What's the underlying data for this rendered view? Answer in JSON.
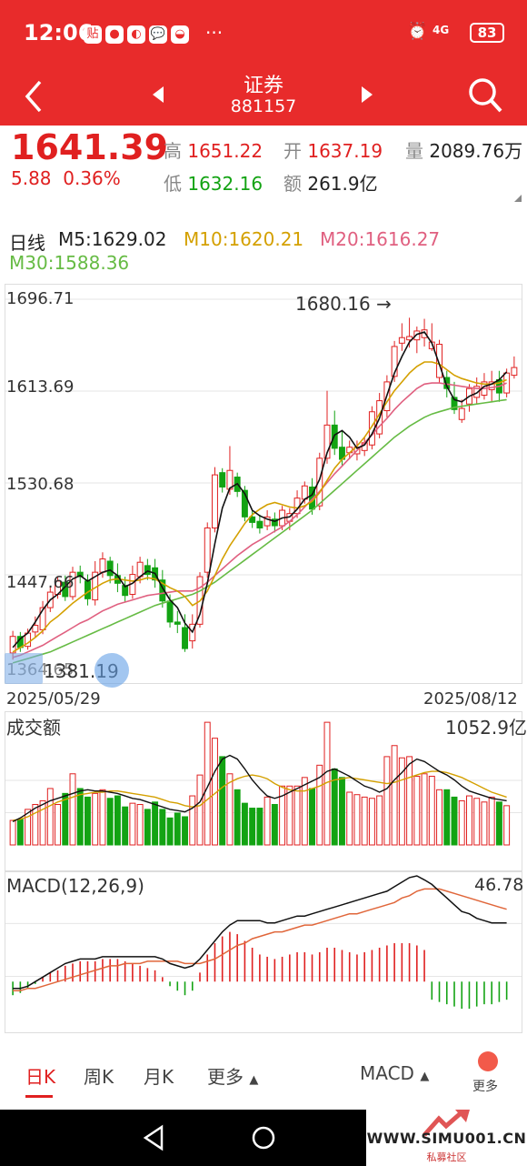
{
  "status": {
    "time": "12:06",
    "apps": [
      "贴",
      "●",
      "◐",
      "💬",
      "◒"
    ],
    "more": "···",
    "alarm": "⏰",
    "net": "4G",
    "battery": "83"
  },
  "nav": {
    "back_icon": "chevron-left-icon",
    "prev_icon": "triangle-left-icon",
    "next_icon": "triangle-right-icon",
    "title": "证券",
    "code": "881157",
    "search_icon": "search-icon"
  },
  "quote": {
    "price": "1641.39",
    "change": "5.88",
    "change_pct": "0.36%",
    "high_label": "高",
    "high": "1651.22",
    "open_label": "开",
    "open": "1637.19",
    "vol_label": "量",
    "vol": "2089.76万",
    "low_label": "低",
    "low": "1632.16",
    "amt_label": "额",
    "amt": "261.9亿"
  },
  "ma": {
    "period": "日线",
    "m5": "M5:1629.02",
    "m10": "M10:1620.21",
    "m20": "M20:1616.27",
    "m30": "M30:1588.36"
  },
  "price_chart": {
    "y_labels": [
      "1696.71",
      "1613.69",
      "1530.68",
      "1447.66",
      "1364.65"
    ],
    "high_marker": "1680.16",
    "low_marker": "1381.19",
    "date_start": "2025/05/29",
    "date_end": "2025/08/12"
  },
  "volume": {
    "label": "成交额",
    "max": "1052.9亿"
  },
  "macd": {
    "label": "MACD(12,26,9)",
    "max": "46.78"
  },
  "bottom_tabs": {
    "day": "日K",
    "week": "周K",
    "month": "月K",
    "more": "更多",
    "indicator": "MACD",
    "extra": "更多"
  },
  "watermark": {
    "site": "WWW.SIMU001.CN",
    "sub": "私募社区"
  },
  "colors": {
    "up": "#e02020",
    "down": "#13a313",
    "ma5": "#111111",
    "ma10": "#d4a000",
    "ma20": "#e06080",
    "ma30": "#66bb44",
    "brand": "#e82b2b"
  },
  "chart_data": [
    {
      "type": "candlestick",
      "title": "日线",
      "x_range": [
        "2025/05/29",
        "2025/08/12"
      ],
      "ylim": [
        1364.65,
        1696.71
      ],
      "y_ticks": [
        1696.71,
        1613.69,
        1530.68,
        1447.66,
        1364.65
      ],
      "annotations": [
        {
          "text": "1680.16",
          "value": 1680.16
        },
        {
          "text": "1381.19",
          "value": 1381.19
        }
      ],
      "candles": [
        [
          1377,
          1392,
          1371,
          1397
        ],
        [
          1392,
          1382,
          1378,
          1396
        ],
        [
          1383,
          1395,
          1380,
          1399
        ],
        [
          1396,
          1402,
          1391,
          1410
        ],
        [
          1398,
          1418,
          1394,
          1424
        ],
        [
          1418,
          1432,
          1414,
          1437
        ],
        [
          1430,
          1442,
          1426,
          1446
        ],
        [
          1441,
          1428,
          1424,
          1447
        ],
        [
          1428,
          1450,
          1425,
          1455
        ],
        [
          1450,
          1446,
          1440,
          1456
        ],
        [
          1442,
          1426,
          1420,
          1448
        ],
        [
          1425,
          1450,
          1420,
          1460
        ],
        [
          1450,
          1462,
          1445,
          1468
        ],
        [
          1460,
          1447,
          1440,
          1464
        ],
        [
          1447,
          1440,
          1432,
          1458
        ],
        [
          1438,
          1429,
          1423,
          1446
        ],
        [
          1430,
          1448,
          1426,
          1456
        ],
        [
          1446,
          1459,
          1440,
          1464
        ],
        [
          1456,
          1448,
          1443,
          1462
        ],
        [
          1454,
          1443,
          1436,
          1462
        ],
        [
          1443,
          1424,
          1418,
          1452
        ],
        [
          1424,
          1405,
          1400,
          1430
        ],
        [
          1405,
          1403,
          1395,
          1415
        ],
        [
          1400,
          1381,
          1378,
          1412
        ],
        [
          1388,
          1403,
          1381,
          1412
        ],
        [
          1403,
          1446,
          1400,
          1450
        ],
        [
          1450,
          1490,
          1445,
          1495
        ],
        [
          1490,
          1538,
          1486,
          1545
        ],
        [
          1540,
          1527,
          1522,
          1544
        ],
        [
          1525,
          1542,
          1520,
          1564
        ],
        [
          1536,
          1523,
          1518,
          1540
        ],
        [
          1524,
          1500,
          1496,
          1528
        ],
        [
          1500,
          1495,
          1490,
          1506
        ],
        [
          1496,
          1490,
          1485,
          1502
        ],
        [
          1492,
          1500,
          1488,
          1506
        ],
        [
          1498,
          1492,
          1486,
          1504
        ],
        [
          1492,
          1506,
          1488,
          1510
        ],
        [
          1496,
          1503,
          1488,
          1508
        ],
        [
          1503,
          1517,
          1499,
          1524
        ],
        [
          1516,
          1528,
          1512,
          1532
        ],
        [
          1527,
          1507,
          1502,
          1535
        ],
        [
          1510,
          1553,
          1506,
          1558
        ],
        [
          1553,
          1583,
          1548,
          1614
        ],
        [
          1583,
          1562,
          1556,
          1596
        ],
        [
          1563,
          1552,
          1546,
          1578
        ],
        [
          1558,
          1563,
          1552,
          1569
        ],
        [
          1557,
          1563,
          1551,
          1569
        ],
        [
          1560,
          1567,
          1555,
          1572
        ],
        [
          1565,
          1595,
          1561,
          1600
        ],
        [
          1575,
          1605,
          1571,
          1612
        ],
        [
          1596,
          1622,
          1590,
          1628
        ],
        [
          1627,
          1654,
          1622,
          1659
        ],
        [
          1657,
          1662,
          1650,
          1675
        ],
        [
          1660,
          1663,
          1653,
          1680
        ],
        [
          1660,
          1668,
          1648,
          1672
        ],
        [
          1662,
          1669,
          1654,
          1679
        ],
        [
          1652,
          1658,
          1650,
          1675
        ],
        [
          1626,
          1656,
          1621,
          1660
        ],
        [
          1626,
          1616,
          1608,
          1632
        ],
        [
          1608,
          1597,
          1593,
          1622
        ],
        [
          1588,
          1598,
          1585,
          1606
        ],
        [
          1602,
          1616,
          1595,
          1620
        ],
        [
          1608,
          1618,
          1602,
          1626
        ],
        [
          1610,
          1622,
          1606,
          1630
        ],
        [
          1615,
          1622,
          1604,
          1632
        ],
        [
          1624,
          1612,
          1604,
          1632
        ],
        [
          1612,
          1630,
          1608,
          1634
        ],
        [
          1628,
          1635,
          1625,
          1645
        ]
      ],
      "ma5": [
        1382,
        1390,
        1395,
        1405,
        1416,
        1425,
        1430,
        1437,
        1444,
        1447,
        1442,
        1446,
        1450,
        1452,
        1447,
        1437,
        1440,
        1446,
        1451,
        1449,
        1436,
        1425,
        1418,
        1404,
        1396,
        1412,
        1440,
        1476,
        1508,
        1526,
        1530,
        1521,
        1506,
        1501,
        1498,
        1496,
        1499,
        1500,
        1507,
        1516,
        1520,
        1534,
        1558,
        1574,
        1578,
        1572,
        1562,
        1565,
        1575,
        1589,
        1610,
        1630,
        1645,
        1658,
        1665,
        1667,
        1657,
        1638,
        1618,
        1606,
        1604,
        1609,
        1612,
        1618,
        1620,
        1624,
        1631
      ],
      "ma10": [
        1378,
        1382,
        1386,
        1391,
        1397,
        1405,
        1410,
        1416,
        1422,
        1427,
        1432,
        1436,
        1440,
        1443,
        1444,
        1443,
        1442,
        1443,
        1445,
        1444,
        1440,
        1436,
        1433,
        1428,
        1420,
        1424,
        1433,
        1447,
        1462,
        1474,
        1484,
        1494,
        1502,
        1507,
        1511,
        1513,
        1511,
        1509,
        1508,
        1510,
        1514,
        1522,
        1533,
        1544,
        1552,
        1558,
        1564,
        1572,
        1582,
        1593,
        1604,
        1614,
        1622,
        1630,
        1636,
        1640,
        1640,
        1638,
        1633,
        1628,
        1625,
        1623,
        1621,
        1620,
        1620,
        1621,
        1624
      ],
      "ma20": [
        1373,
        1375,
        1378,
        1381,
        1384,
        1388,
        1392,
        1396,
        1400,
        1404,
        1407,
        1411,
        1415,
        1418,
        1421,
        1423,
        1425,
        1427,
        1429,
        1430,
        1431,
        1432,
        1433,
        1433,
        1433,
        1436,
        1441,
        1447,
        1453,
        1459,
        1465,
        1470,
        1475,
        1479,
        1483,
        1487,
        1491,
        1496,
        1502,
        1509,
        1516,
        1523,
        1531,
        1539,
        1546,
        1553,
        1560,
        1567,
        1574,
        1582,
        1589,
        1597,
        1604,
        1610,
        1616,
        1620,
        1621,
        1621,
        1620,
        1619,
        1618,
        1617,
        1616,
        1616,
        1617,
        1618,
        1621
      ],
      "ma30": [
        1368,
        1370,
        1372,
        1374,
        1376,
        1378,
        1381,
        1384,
        1387,
        1390,
        1393,
        1396,
        1399,
        1402,
        1405,
        1408,
        1411,
        1414,
        1417,
        1420,
        1422,
        1424,
        1426,
        1428,
        1430,
        1433,
        1437,
        1441,
        1446,
        1451,
        1456,
        1461,
        1466,
        1471,
        1476,
        1481,
        1486,
        1491,
        1496,
        1501,
        1506,
        1512,
        1518,
        1524,
        1530,
        1536,
        1542,
        1548,
        1554,
        1560,
        1566,
        1572,
        1577,
        1582,
        1586,
        1590,
        1593,
        1595,
        1597,
        1599,
        1600,
        1601,
        1602,
        1603,
        1604,
        1605,
        1606
      ]
    },
    {
      "type": "bar",
      "title": "成交额",
      "ylim": [
        0,
        1052.9
      ],
      "values": [
        200,
        210,
        290,
        330,
        360,
        460,
        330,
        420,
        580,
        460,
        390,
        420,
        450,
        380,
        400,
        310,
        340,
        330,
        290,
        350,
        290,
        220,
        260,
        230,
        400,
        570,
        1000,
        870,
        720,
        580,
        450,
        340,
        300,
        300,
        390,
        330,
        480,
        480,
        480,
        550,
        460,
        650,
        1000,
        620,
        550,
        430,
        410,
        390,
        380,
        400,
        720,
        810,
        710,
        720,
        560,
        580,
        560,
        450,
        450,
        390,
        360,
        400,
        380,
        350,
        390,
        350,
        320
      ],
      "ma5": [
        190,
        220,
        260,
        300,
        330,
        360,
        380,
        400,
        420,
        440,
        450,
        440,
        440,
        430,
        420,
        400,
        380,
        370,
        350,
        330,
        310,
        290,
        280,
        270,
        300,
        350,
        470,
        600,
        700,
        730,
        700,
        620,
        530,
        460,
        400,
        380,
        400,
        430,
        460,
        490,
        520,
        550,
        600,
        620,
        590,
        560,
        520,
        480,
        460,
        430,
        460,
        530,
        590,
        660,
        700,
        680,
        640,
        600,
        570,
        530,
        480,
        440,
        420,
        400,
        380,
        370,
        360
      ],
      "ma10": [
        200,
        210,
        230,
        260,
        290,
        320,
        350,
        370,
        390,
        410,
        420,
        430,
        430,
        440,
        440,
        430,
        420,
        410,
        400,
        390,
        370,
        350,
        340,
        320,
        310,
        320,
        370,
        420,
        470,
        510,
        540,
        560,
        570,
        560,
        540,
        500,
        470,
        450,
        440,
        440,
        460,
        480,
        510,
        530,
        540,
        550,
        540,
        530,
        520,
        510,
        500,
        510,
        530,
        550,
        570,
        590,
        600,
        600,
        590,
        570,
        550,
        520,
        490,
        460,
        430,
        410,
        390
      ]
    },
    {
      "type": "bar",
      "title": "MACD(12,26,9)",
      "ylim": [
        -20,
        46.78
      ],
      "values": [
        -6,
        -5,
        -3,
        -1,
        2,
        4,
        5,
        7,
        8,
        9,
        9,
        9,
        10,
        10,
        10,
        9,
        8,
        7,
        6,
        5,
        2,
        -2,
        -4,
        -6,
        -4,
        4,
        12,
        17,
        20,
        22,
        21,
        18,
        15,
        12,
        11,
        10,
        11,
        12,
        13,
        13,
        12,
        13,
        15,
        15,
        14,
        13,
        12,
        13,
        14,
        15,
        16,
        17,
        17,
        17,
        16,
        14,
        -8,
        -9,
        -10,
        -11,
        -12,
        -12,
        -11,
        -10,
        -10,
        -9,
        -8
      ],
      "dif": [
        -3,
        -3,
        -2,
        0,
        2,
        4,
        6,
        8,
        9,
        10,
        10,
        10,
        11,
        11,
        11,
        11,
        11,
        11,
        11,
        11,
        10,
        8,
        7,
        6,
        7,
        10,
        14,
        18,
        22,
        25,
        27,
        27,
        27,
        27,
        26,
        26,
        27,
        28,
        29,
        29,
        30,
        31,
        32,
        33,
        34,
        35,
        36,
        37,
        38,
        39,
        40,
        42,
        44,
        46,
        46.78,
        45,
        43,
        40,
        37,
        34,
        31,
        30,
        28,
        27,
        26,
        26,
        26
      ],
      "dea": [
        -4,
        -4,
        -3,
        -3,
        -2,
        -1,
        0,
        1,
        2,
        3,
        4,
        5,
        6,
        7,
        7,
        8,
        8,
        8,
        9,
        9,
        9,
        9,
        9,
        8,
        8,
        8,
        9,
        10,
        12,
        14,
        16,
        17,
        19,
        20,
        21,
        22,
        22,
        23,
        24,
        25,
        25,
        26,
        27,
        28,
        29,
        30,
        30,
        31,
        32,
        33,
        34,
        35,
        37,
        38,
        40,
        41,
        41,
        41,
        40,
        39,
        38,
        37,
        36,
        35,
        34,
        33,
        32
      ]
    }
  ]
}
